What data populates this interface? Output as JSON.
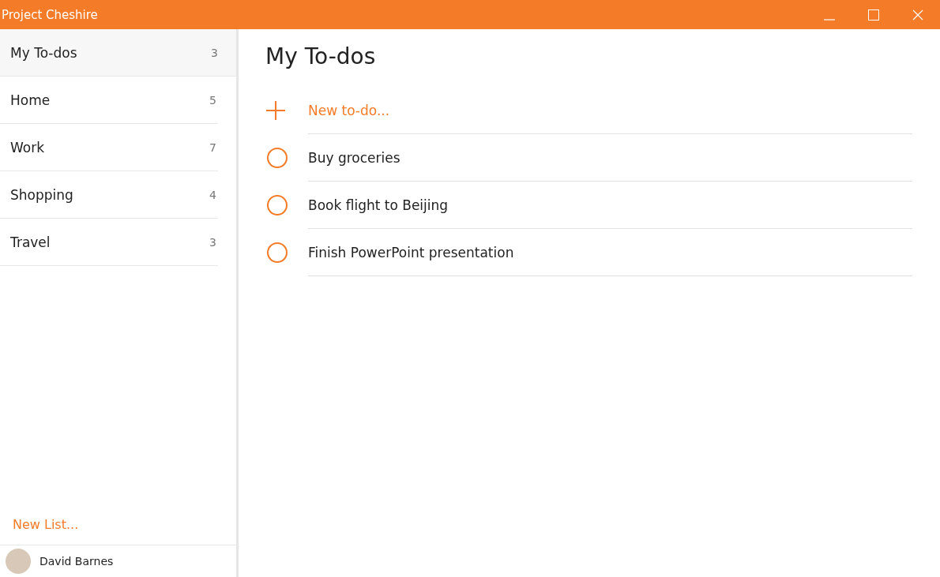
{
  "window": {
    "title": "Project Cheshire"
  },
  "sidebar": {
    "lists": [
      {
        "name": "My To-dos",
        "count": "3",
        "selected": true
      },
      {
        "name": "Home",
        "count": "5",
        "selected": false
      },
      {
        "name": "Work",
        "count": "7",
        "selected": false
      },
      {
        "name": "Shopping",
        "count": "4",
        "selected": false
      },
      {
        "name": "Travel",
        "count": "3",
        "selected": false
      }
    ],
    "new_list": "New List...",
    "user": {
      "name": "David Barnes"
    }
  },
  "main": {
    "title": "My To-dos",
    "new_todo": "New to-do...",
    "todos": [
      {
        "text": "Buy groceries",
        "checked": false
      },
      {
        "text": "Book flight to Beijing",
        "checked": false
      },
      {
        "text": "Finish PowerPoint presentation",
        "checked": false
      }
    ]
  }
}
